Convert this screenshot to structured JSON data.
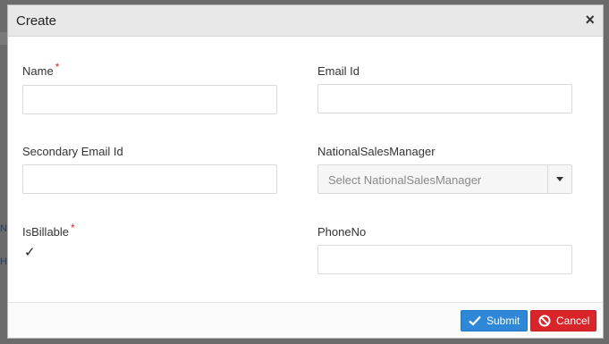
{
  "background": {
    "side_letters": [
      "N",
      "H"
    ]
  },
  "modal": {
    "title": "Create",
    "close_glyph": "×",
    "fields": {
      "name": {
        "label": "Name",
        "required_mark": "*",
        "value": ""
      },
      "email": {
        "label": "Email Id",
        "value": ""
      },
      "secondary_email": {
        "label": "Secondary Email Id",
        "value": ""
      },
      "national_sales_manager": {
        "label": "NationalSalesManager",
        "placeholder": "Select NationalSalesManager"
      },
      "is_billable": {
        "label": "IsBillable",
        "required_mark": "*",
        "checked_glyph": "✓"
      },
      "phone": {
        "label": "PhoneNo",
        "value": ""
      }
    },
    "buttons": {
      "submit": "Submit",
      "cancel": "Cancel"
    }
  },
  "colors": {
    "submit": "#2f87d8",
    "cancel": "#d9252a",
    "required": "#d9252a"
  }
}
